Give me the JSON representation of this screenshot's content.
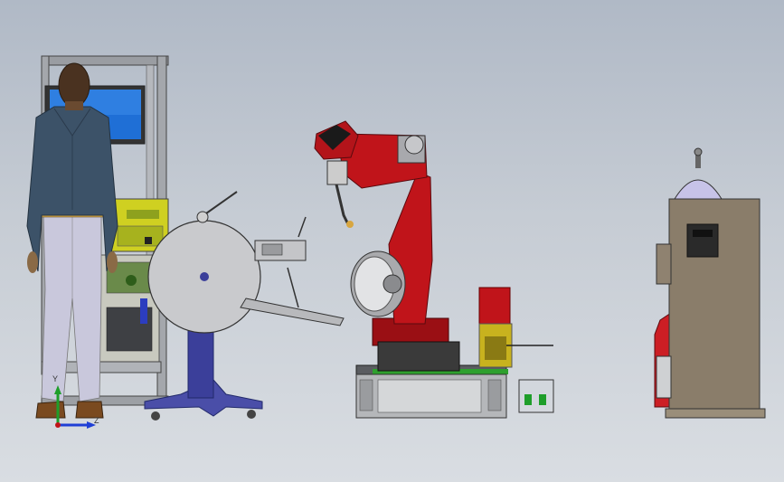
{
  "scene": {
    "type": "cad-assembly-view",
    "background_gradient": [
      "#b0b9c6",
      "#d9dde2"
    ],
    "colors": {
      "robot": "#c0141a",
      "robot_dark": "#7a0a0e",
      "reel_stand": "#3b3f9a",
      "frame": "#8a8d92",
      "cabinet": "#8a7d6a",
      "dome": "#c7c3e8",
      "accent_green": "#1e9e2a",
      "accent_yellow": "#c8c21e"
    },
    "components": [
      {
        "name": "operator",
        "icon": "person-figure"
      },
      {
        "name": "control-station",
        "icon": "monitor-frame"
      },
      {
        "name": "wire-reel-stand",
        "icon": "spool"
      },
      {
        "name": "welding-robot",
        "icon": "robot-arm"
      },
      {
        "name": "robot-base-platform",
        "icon": "platform"
      },
      {
        "name": "gas-cabinet",
        "icon": "cabinet"
      }
    ]
  },
  "triad": {
    "y_label": "Y",
    "z_label": "Z",
    "y_color": "#1e9e2a",
    "z_color": "#1f3fd6"
  }
}
